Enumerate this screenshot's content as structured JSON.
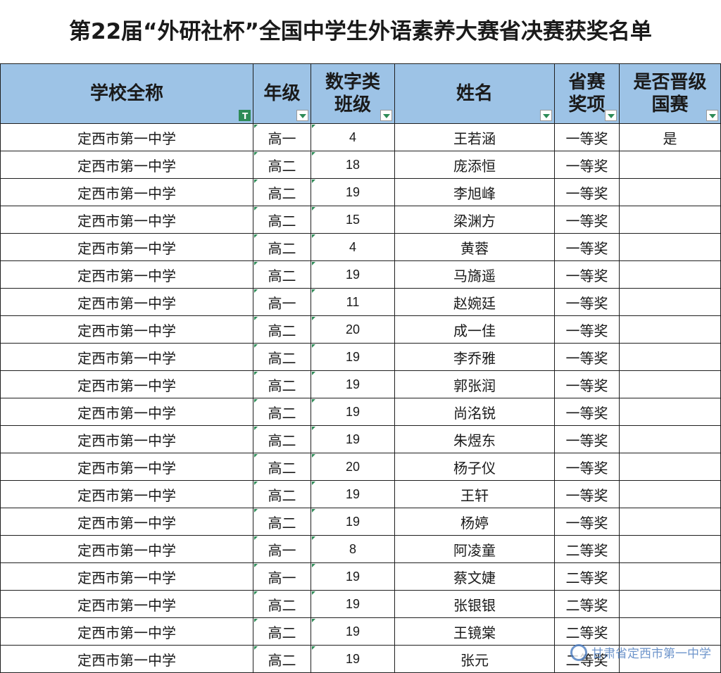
{
  "title": "第22届“外研社杯”全国中学生外语素养大赛省决赛获奖名单",
  "headers": {
    "school": "学校全称",
    "grade": "年级",
    "class_line1": "数字类",
    "class_line2": "班级",
    "name": "姓名",
    "award_line1": "省赛",
    "award_line2": "奖项",
    "advance_line1": "是否晋级",
    "advance_line2": "国赛"
  },
  "rows": [
    {
      "school": "定西市第一中学",
      "grade": "高一",
      "class": "4",
      "name": "王若涵",
      "award": "一等奖",
      "advance": "是"
    },
    {
      "school": "定西市第一中学",
      "grade": "高二",
      "class": "18",
      "name": "庞添恒",
      "award": "一等奖",
      "advance": ""
    },
    {
      "school": "定西市第一中学",
      "grade": "高二",
      "class": "19",
      "name": "李旭峰",
      "award": "一等奖",
      "advance": ""
    },
    {
      "school": "定西市第一中学",
      "grade": "高二",
      "class": "15",
      "name": "梁渊方",
      "award": "一等奖",
      "advance": ""
    },
    {
      "school": "定西市第一中学",
      "grade": "高二",
      "class": "4",
      "name": "黄蓉",
      "award": "一等奖",
      "advance": ""
    },
    {
      "school": "定西市第一中学",
      "grade": "高二",
      "class": "19",
      "name": "马旖遥",
      "award": "一等奖",
      "advance": ""
    },
    {
      "school": "定西市第一中学",
      "grade": "高一",
      "class": "11",
      "name": "赵婉廷",
      "award": "一等奖",
      "advance": ""
    },
    {
      "school": "定西市第一中学",
      "grade": "高二",
      "class": "20",
      "name": "成一佳",
      "award": "一等奖",
      "advance": ""
    },
    {
      "school": "定西市第一中学",
      "grade": "高二",
      "class": "19",
      "name": "李乔雅",
      "award": "一等奖",
      "advance": ""
    },
    {
      "school": "定西市第一中学",
      "grade": "高二",
      "class": "19",
      "name": "郭张润",
      "award": "一等奖",
      "advance": ""
    },
    {
      "school": "定西市第一中学",
      "grade": "高二",
      "class": "19",
      "name": "尚洺锐",
      "award": "一等奖",
      "advance": ""
    },
    {
      "school": "定西市第一中学",
      "grade": "高二",
      "class": "19",
      "name": "朱煜东",
      "award": "一等奖",
      "advance": ""
    },
    {
      "school": "定西市第一中学",
      "grade": "高二",
      "class": "20",
      "name": "杨子仪",
      "award": "一等奖",
      "advance": ""
    },
    {
      "school": "定西市第一中学",
      "grade": "高二",
      "class": "19",
      "name": "王轩",
      "award": "一等奖",
      "advance": ""
    },
    {
      "school": "定西市第一中学",
      "grade": "高二",
      "class": "19",
      "name": "杨婷",
      "award": "一等奖",
      "advance": ""
    },
    {
      "school": "定西市第一中学",
      "grade": "高一",
      "class": "8",
      "name": "阿凌童",
      "award": "二等奖",
      "advance": ""
    },
    {
      "school": "定西市第一中学",
      "grade": "高一",
      "class": "19",
      "name": "蔡文婕",
      "award": "二等奖",
      "advance": ""
    },
    {
      "school": "定西市第一中学",
      "grade": "高二",
      "class": "19",
      "name": "张银银",
      "award": "二等奖",
      "advance": ""
    },
    {
      "school": "定西市第一中学",
      "grade": "高二",
      "class": "19",
      "name": "王镜棠",
      "award": "二等奖",
      "advance": ""
    },
    {
      "school": "定西市第一中学",
      "grade": "高二",
      "class": "19",
      "name": "张元",
      "award": "二等奖",
      "advance": ""
    }
  ],
  "watermark": "甘肃省定西市第一中学",
  "colors": {
    "header_bg": "#9dc3e6",
    "filter_green": "#2e8b57"
  }
}
